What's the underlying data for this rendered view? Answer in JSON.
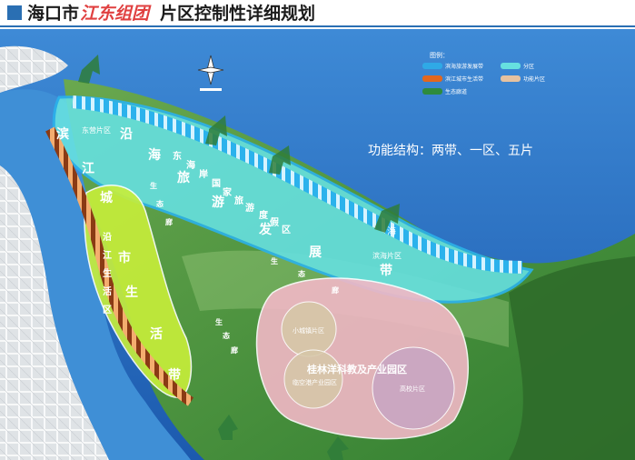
{
  "title": {
    "prefix": "海口市",
    "name": "江东组团",
    "suffix": "片区控制性详细规划"
  },
  "function_structure": "功能结构：两带、一区、五片",
  "legend": {
    "title": "图例：",
    "items": [
      {
        "label": "滨海旅游发展带",
        "color": "#2fa9e6"
      },
      {
        "label": "分区",
        "color": "#66e0e0"
      },
      {
        "label": "滨江城市生活带",
        "color": "#e2671e"
      },
      {
        "label": "功能片区",
        "color": "#e6c2a0"
      },
      {
        "label": "生态廊道",
        "color": "#2e8b3e"
      }
    ]
  },
  "belts": {
    "coastal": {
      "chars": [
        "沿",
        "海",
        "旅",
        "游",
        "发",
        "展",
        "带"
      ]
    },
    "river": {
      "chars": [
        "滨",
        "江",
        "城",
        "市",
        "生",
        "活",
        "带"
      ]
    }
  },
  "zone": {
    "chars": [
      "东",
      "海",
      "岸",
      "国",
      "家",
      "旅",
      "游",
      "度",
      "假",
      "区"
    ]
  },
  "eco_corridor_1": {
    "chars": [
      "生",
      "态",
      "廊"
    ]
  },
  "eco_corridor_2": {
    "chars": [
      "生",
      "态",
      "廊"
    ]
  },
  "eco_corridor_3": {
    "chars": [
      "生",
      "态",
      "廊"
    ]
  },
  "district_labels": {
    "dongying": "东营片区",
    "yanjiang": {
      "chars": [
        "沿",
        "江",
        "生",
        "活",
        "区"
      ]
    },
    "xiaoweiling": "滨海片区",
    "science_park": "桂林洋科教及产业园区",
    "small_town": "小城镇片区",
    "industry": "临空港产业园区",
    "university": "高校片区",
    "coast": "海"
  },
  "colors": {
    "sea": "#1a5fb4",
    "river": "#3f8fd6",
    "green": "#3f9a3a",
    "cyan": "#66e0e0",
    "lime": "#c8ef3a",
    "pink": "#f2b8c6",
    "orange": "#e2671e"
  }
}
